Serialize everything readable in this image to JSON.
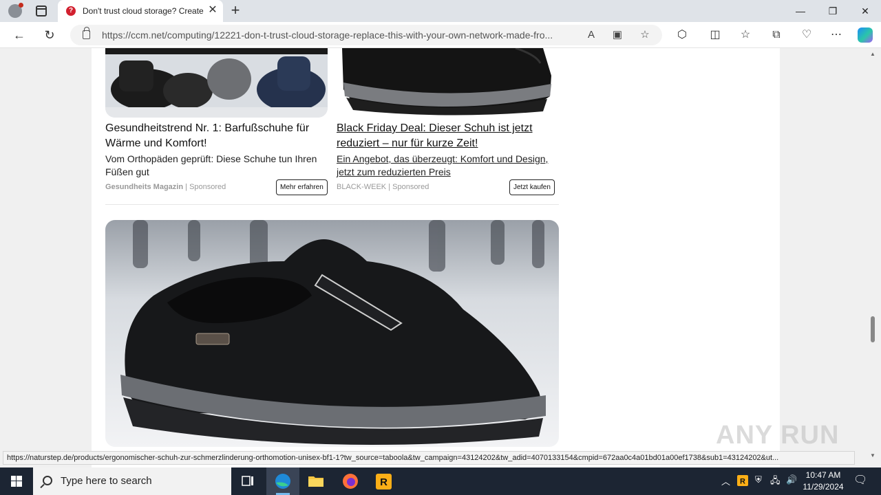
{
  "browser": {
    "tab_title": "Don't trust cloud storage? Create",
    "url": "https://ccm.net/computing/12221-don-t-trust-cloud-storage-replace-this-with-your-own-network-made-fro...",
    "new_tab_label": "+",
    "tab_close_label": "✕"
  },
  "ads": {
    "left": {
      "title": "Gesundheitstrend Nr. 1: Barfußschuhe für Wärme und Komfort!",
      "description": "Vom Orthopäden geprüft: Diese Schuhe tun Ihren Füßen gut",
      "source": "Gesundheits Magazin",
      "sponsored": "Sponsored",
      "button": "Mehr erfahren"
    },
    "right": {
      "title": "Black Friday Deal: Dieser Schuh ist jetzt reduziert – nur für kurze Zeit!",
      "description": "Ein Angebot, das überzeugt: Komfort und Design, jetzt zum reduzierten Preis",
      "source": "BLACK-WEEK",
      "sponsored": "Sponsored",
      "button": "Jetzt kaufen"
    }
  },
  "status_url": "https://naturstep.de/products/ergonomischer-schuh-zur-schmerzlinderung-orthomotion-unisex-bf1-1?tw_source=taboola&tw_campaign=43124202&tw_adid=4070133154&cmpid=672aa0c4a01bd01a00ef1738&sub1=43124202&ut...",
  "watermark": "ANY RUN",
  "taskbar": {
    "search_placeholder": "Type here to search",
    "time": "10:47 AM",
    "date": "11/29/2024"
  },
  "colors": {
    "taskbar": "#1c2533",
    "tab_favicon": "#d2202f",
    "accent": "#0078d4"
  }
}
